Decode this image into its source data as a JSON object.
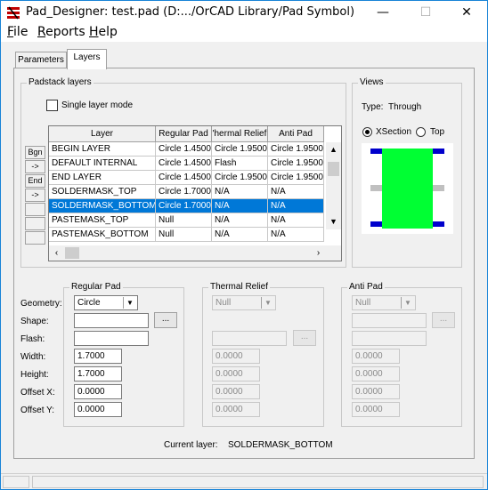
{
  "window": {
    "title": "Pad_Designer: test.pad (D:.../OrCAD Library/Pad Symbol)",
    "minimize": "—",
    "maximize": "☐",
    "close": "✕"
  },
  "menu": {
    "items": [
      {
        "label": "File",
        "key": "F",
        "rest": "ile"
      },
      {
        "label": "Reports",
        "key": "R",
        "rest": "eports"
      },
      {
        "label": "Help",
        "key": "H",
        "rest": "elp"
      }
    ]
  },
  "tabs": [
    {
      "label": "Parameters",
      "active": false
    },
    {
      "label": "Layers",
      "active": true
    }
  ],
  "padstack": {
    "title": "Padstack layers",
    "single_layer_label": "Single layer mode",
    "single_layer_checked": false,
    "columns": [
      "Layer",
      "Regular Pad",
      "Thermal Relief",
      "Anti Pad"
    ],
    "column_display": [
      "Layer",
      "Regular Pad",
      "'hermal Relief",
      "Anti Pad"
    ],
    "row_buttons": [
      "Bgn",
      "->",
      "End",
      "->",
      "",
      "",
      ""
    ],
    "rows": [
      [
        "BEGIN LAYER",
        "Circle 1.4500",
        "Circle 1.9500",
        "Circle 1.9500"
      ],
      [
        "DEFAULT INTERNAL",
        "Circle 1.4500",
        "Flash",
        "Circle 1.9500"
      ],
      [
        "END LAYER",
        "Circle 1.4500",
        "Circle 1.9500",
        "Circle 1.9500"
      ],
      [
        "SOLDERMASK_TOP",
        "Circle 1.7000",
        "N/A",
        "N/A"
      ],
      [
        "SOLDERMASK_BOTTOM",
        "Circle 1.7000",
        "N/A",
        "N/A"
      ],
      [
        "PASTEMASK_TOP",
        "Null",
        "N/A",
        "N/A"
      ],
      [
        "PASTEMASK_BOTTOM",
        "Null",
        "N/A",
        "N/A"
      ]
    ],
    "selected_row": 4
  },
  "views": {
    "title": "Views",
    "type_label": "Type:",
    "type_value": "Through",
    "xsection_label": "XSection",
    "top_label": "Top",
    "selected": "XSection",
    "colors": {
      "pad": "#00ff33",
      "layer": "#0000cc",
      "internal": "#c0c0c0",
      "background": "#ffffff"
    }
  },
  "regular_pad": {
    "title": "Regular Pad",
    "geometry": "Circle",
    "shape": "",
    "flash": "",
    "width": "1.7000",
    "height": "1.7000",
    "offset_x": "0.0000",
    "offset_y": "0.0000"
  },
  "thermal_relief": {
    "title": "Thermal Relief",
    "geometry": "Null",
    "width": "0.0000",
    "height": "0.0000",
    "offset_x": "0.0000",
    "offset_y": "0.0000"
  },
  "anti_pad": {
    "title": "Anti Pad",
    "geometry": "Null",
    "width": "0.0000",
    "height": "0.0000",
    "offset_x": "0.0000",
    "offset_y": "0.0000"
  },
  "field_labels": {
    "geometry": "Geometry:",
    "shape": "Shape:",
    "flash": "Flash:",
    "width": "Width:",
    "height": "Height:",
    "offset_x": "Offset X:",
    "offset_y": "Offset Y:"
  },
  "browse_label": "...",
  "current_layer": {
    "label": "Current layer:",
    "value": "SOLDERMASK_BOTTOM"
  }
}
